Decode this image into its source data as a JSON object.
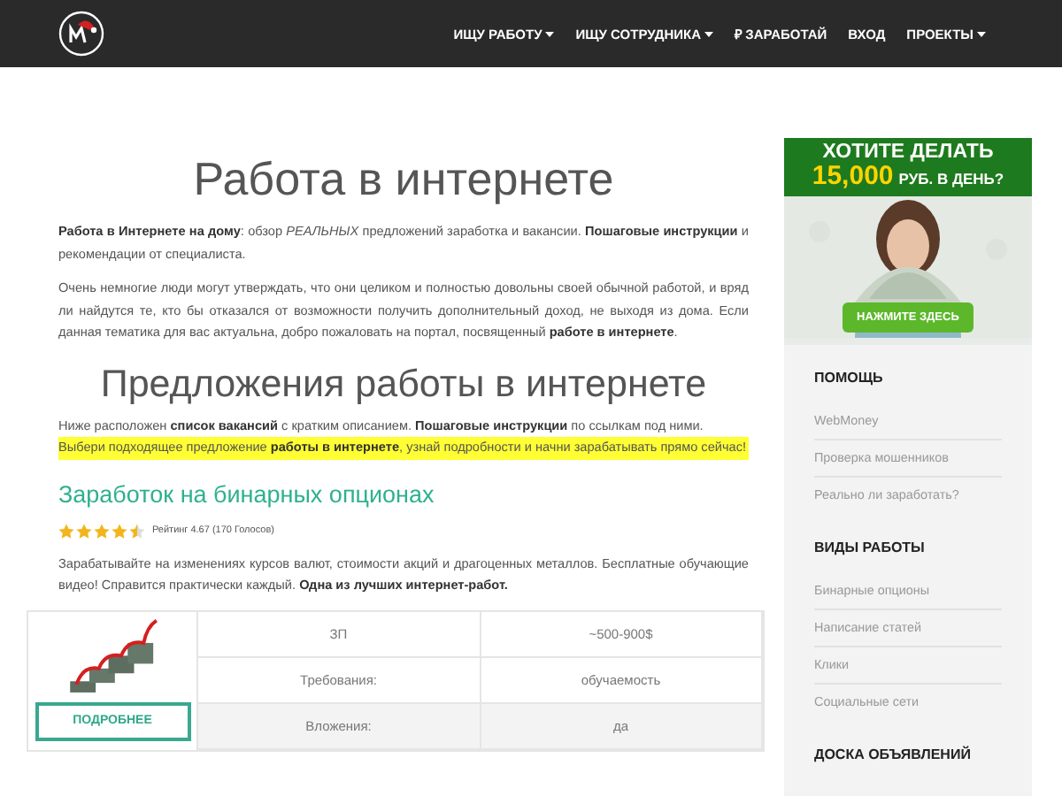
{
  "nav": {
    "items": [
      {
        "label": "ИЩУ РАБОТУ",
        "dropdown": true
      },
      {
        "label": "ИЩУ СОТРУДНИКА",
        "dropdown": true
      },
      {
        "label": "₽ ЗАРАБОТАЙ",
        "dropdown": false
      },
      {
        "label": "ВХОД",
        "dropdown": false
      },
      {
        "label": "ПРОЕКТЫ",
        "dropdown": true
      }
    ]
  },
  "main": {
    "title": "Работа в интернете",
    "paragraphs": [
      "**Работа в Интернете на дому**: обзор *РЕАЛЬНЫХ* предложений заработка и вакансии. **Пошаговые инструкции** и рекомендации от специалиста.",
      "Очень немногие люди могут утверждать, что они целиком и полностью довольны своей обычной работой, и вряд ли найдутся те, кто бы отказался от возможности получить дополнительный доход, не выходя из дома. Если данная тематика для вас актуальна, добро пожаловать на портал, посвященный **работе в интернете**."
    ],
    "section_title": "Предложения работы в интернете",
    "section_text": "Ниже расположен **список вакансий** с кратким описанием. **Пошаговые инструкции** по ссылкам под ними.",
    "highlight_text": "Выбери подходящее предложение **работы в интернете**, узнай подробности и начни зарабатывать прямо сейчас!",
    "offer": {
      "title": "Заработок на бинарных опционах",
      "stars": 4.5,
      "rating": "Рейтинг 4.67 (170 Голосов)",
      "description": "Зарабатывайте на изменениях курсов валют, стоимости акций и драгоценных металлов. Бесплатные обучающие видео! Справится практически каждый. **Одна из лучших интернет-работ.**",
      "button": "ПОДРОБНЕЕ",
      "rows": [
        {
          "label": "ЗП",
          "value": "~500-900$",
          "shaded": false
        },
        {
          "label": "Требования:",
          "value": "обучаемость",
          "shaded": false
        },
        {
          "label": "Вложения:",
          "value": "да",
          "shaded": true
        }
      ]
    }
  },
  "sidebar": {
    "banner": {
      "headline": "ХОТИТЕ ДЕЛАТЬ",
      "amount": "15,000",
      "amount_suffix": "РУБ. В ДЕНЬ?",
      "cta": "НАЖМИТЕ ЗДЕСЬ"
    },
    "sections": [
      {
        "title": "ПОМОЩЬ",
        "items": [
          "WebMoney",
          "Проверка мошенников",
          "Реально ли заработать?"
        ]
      },
      {
        "title": "ВИДЫ РАБОТЫ",
        "items": [
          "Бинарные опционы",
          "Написание статей",
          "Клики",
          "Социальные сети"
        ]
      },
      {
        "title": "ДОСКА ОБЪЯВЛЕНИЙ"
      }
    ]
  }
}
